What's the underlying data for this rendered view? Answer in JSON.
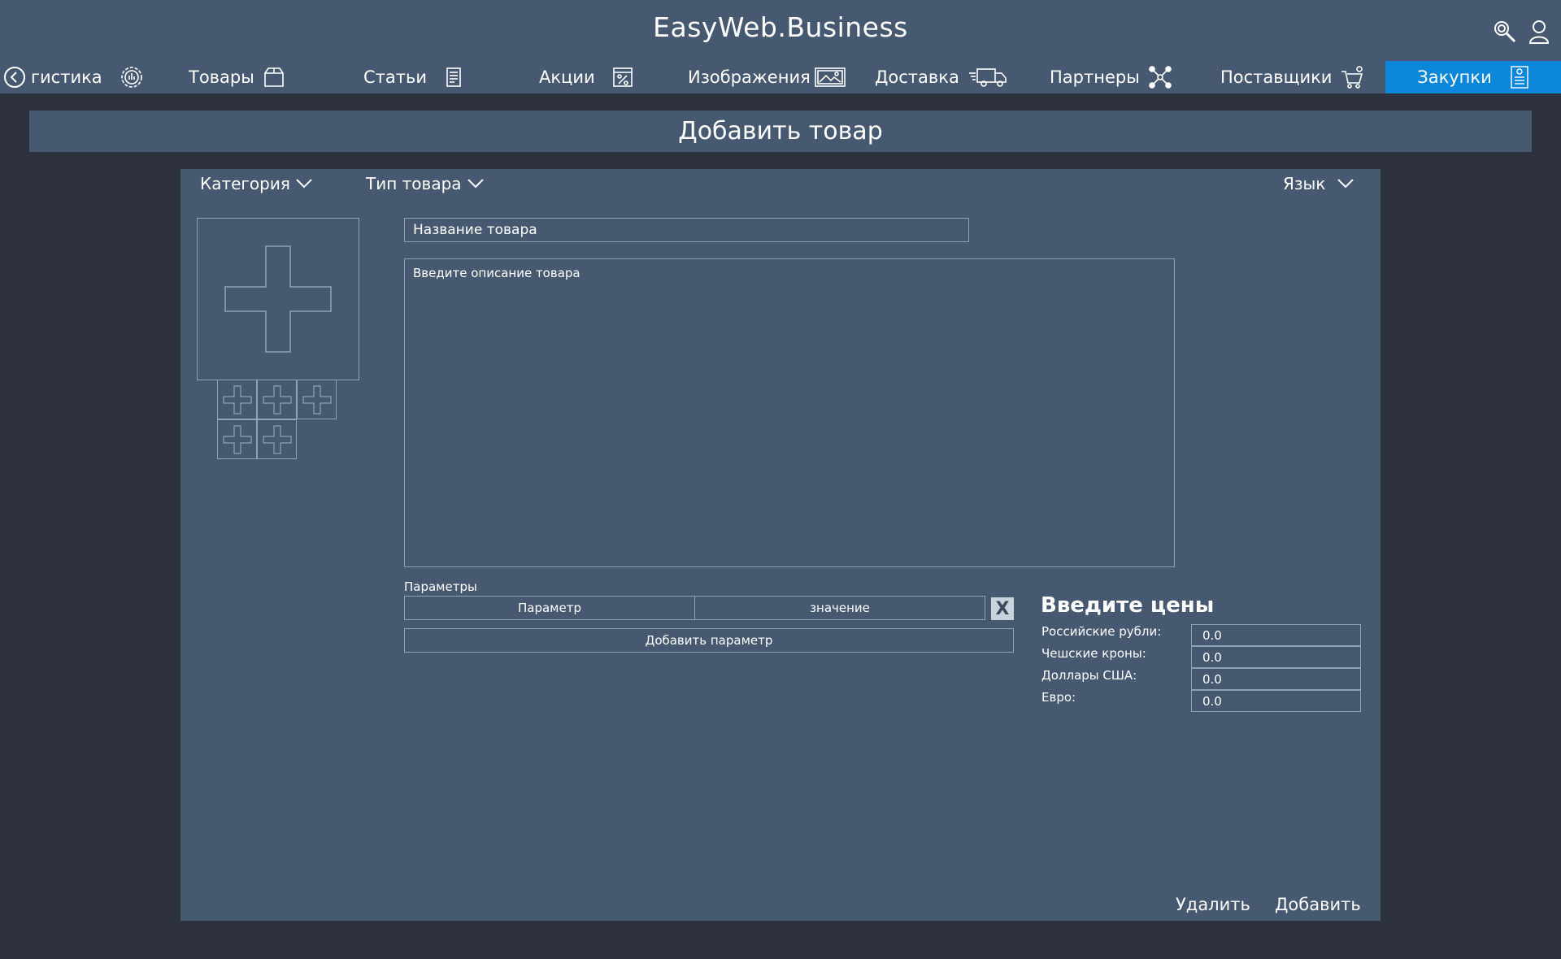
{
  "header": {
    "brand": "EasyWeb.Business"
  },
  "nav": {
    "items": [
      {
        "label": "гистика",
        "icon": "analytics-icon"
      },
      {
        "label": "Товары",
        "icon": "box-icon"
      },
      {
        "label": "Статьи",
        "icon": "document-icon"
      },
      {
        "label": "Акции",
        "icon": "discount-icon"
      },
      {
        "label": "Изображения",
        "icon": "image-icon"
      },
      {
        "label": "Доставка",
        "icon": "truck-icon"
      },
      {
        "label": "Партнеры",
        "icon": "partners-icon"
      },
      {
        "label": "Поставщики",
        "icon": "cart-icon"
      },
      {
        "label": "Закупки",
        "icon": "receipt-icon",
        "active": true
      }
    ],
    "active_color": "#0b86d8"
  },
  "page": {
    "title": "Добавить товар"
  },
  "form": {
    "category_label": "Категория",
    "type_label": "Тип товара",
    "language_label": "Язык",
    "name_placeholder": "Название товара",
    "description_placeholder": "Введите описание товара",
    "params_label": "Параметры",
    "param_placeholder": "Параметр",
    "value_placeholder": "значение",
    "remove_param": "X",
    "add_param_label": "Добавить параметр"
  },
  "prices": {
    "title": "Введите цены",
    "rows": [
      {
        "label": "Российские рубли:",
        "value": "0.0"
      },
      {
        "label": "Чешские кроны:",
        "value": "0.0"
      },
      {
        "label": "Доллары США:",
        "value": "0.0"
      },
      {
        "label": "Евро:",
        "value": "0.0"
      }
    ]
  },
  "actions": {
    "delete_label": "Удалить",
    "add_label": "Добавить"
  },
  "colors": {
    "background": "#2d323e",
    "panel": "#465970",
    "accent": "#0b86d8"
  }
}
